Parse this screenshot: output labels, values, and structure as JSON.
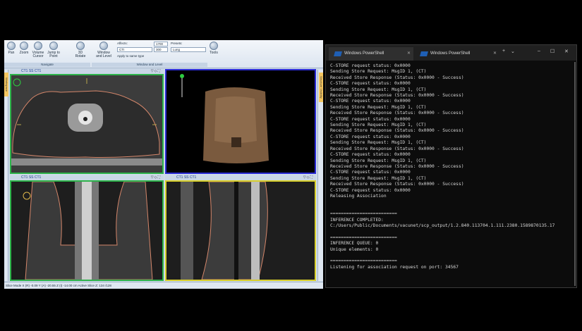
{
  "ribbon": {
    "buttons": [
      {
        "label": "Pan"
      },
      {
        "label": "Zoom"
      },
      {
        "label": "Volume\nCursor"
      },
      {
        "label": "Jump to\nPoint"
      },
      {
        "label": "3D\nRotate"
      },
      {
        "label": "Window\nand Level"
      },
      {
        "label": "Tools"
      }
    ],
    "affects_label": "Affects:",
    "affects_value": "CTI",
    "window_value": "1700",
    "level_value": "300",
    "presets_label": "Presets:",
    "presets_value": "Lung",
    "apply_same_type": "Apply to same type",
    "group_navigate": "Navigate",
    "group_window_level": "Window and Level"
  },
  "side_tabs": {
    "left": "Workspace",
    "right": "Structure Visibility"
  },
  "viewports": [
    {
      "title": "CT1   SS CT1",
      "border": "#2db34a"
    },
    {
      "title": "",
      "border": "#2b2bd6"
    },
    {
      "title": "CT1   SS CT1",
      "border": "#2db34a"
    },
    {
      "title": "CT1   SS CT1",
      "border": "#d8cf2a"
    }
  ],
  "statusbar": {
    "text": "Slice Mode  X (R)  -0.09   Y (A)  -20.55   Z (I)  -14.00  cm   Active Slice Z: 134  /128"
  },
  "terminal": {
    "tab_active": "Windows PowerShell",
    "tab_inactive": "Windows PowerShell",
    "lines": [
      "C-STORE request status: 0x0000",
      "Sending Store Request: MsgID 1, (CT)",
      "Received Store Response (Status: 0x0000 - Success)",
      "C-STORE request status: 0x0000",
      "Sending Store Request: MsgID 1, (CT)",
      "Received Store Response (Status: 0x0000 - Success)",
      "C-STORE request status: 0x0000",
      "Sending Store Request: MsgID 1, (CT)",
      "Received Store Response (Status: 0x0000 - Success)",
      "C-STORE request status: 0x0000",
      "Sending Store Request: MsgID 1, (CT)",
      "Received Store Response (Status: 0x0000 - Success)",
      "C-STORE request status: 0x0000",
      "Sending Store Request: MsgID 1, (CT)",
      "Received Store Response (Status: 0x0000 - Success)",
      "C-STORE request status: 0x0000",
      "Sending Store Request: MsgID 1, (CT)",
      "Received Store Response (Status: 0x0000 - Success)",
      "C-STORE request status: 0x0000",
      "Sending Store Request: MsgID 1, (CT)",
      "Received Store Response (Status: 0x0000 - Success)",
      "C-STORE request status: 0x0000",
      "Releasing Association",
      "",
      "",
      "=========================",
      "INFERENCE COMPLETED:",
      "C:/Users/Public/Documents/vacunet/scp_output/1.2.840.113704.1.111.2380.1589870135.17",
      "",
      "=========================",
      "INFERENCE QUEUE: 0",
      "Unique elements: 0",
      "",
      "=========================",
      "Listening for association request on port: 34567"
    ]
  }
}
